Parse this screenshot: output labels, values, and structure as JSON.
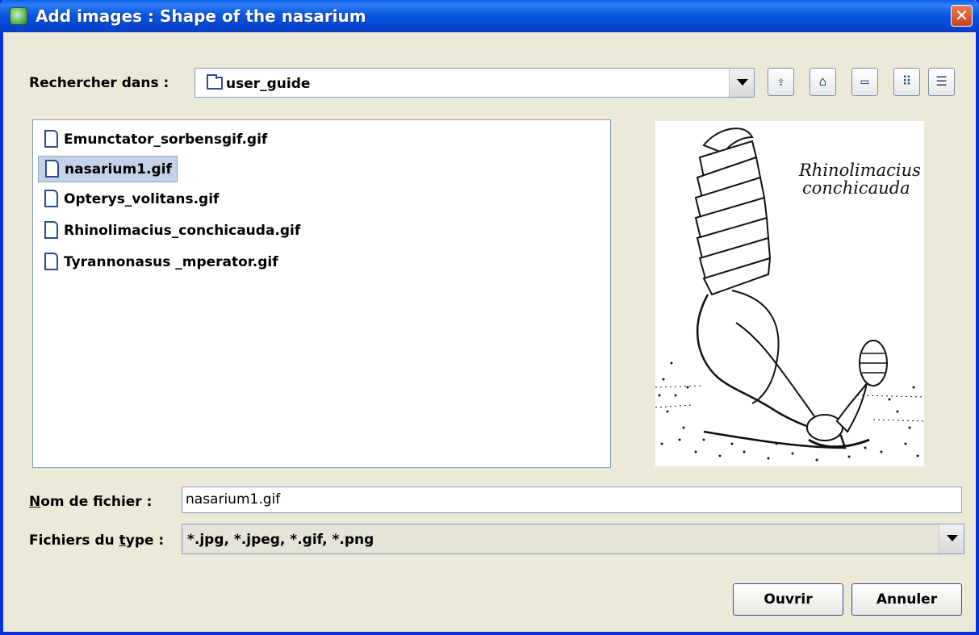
{
  "window": {
    "title": "Add images : Shape of the nasarium",
    "close_symbol": "✕"
  },
  "lookin": {
    "label": "Rechercher dans :",
    "value": "user_guide"
  },
  "toolbar": {
    "icons": [
      "up-folder-icon",
      "home-icon",
      "new-folder-icon",
      "list-view-icon",
      "details-view-icon"
    ]
  },
  "files": [
    {
      "name": "Emunctator_sorbensgif.gif",
      "selected": false
    },
    {
      "name": "nasarium1.gif",
      "selected": true
    },
    {
      "name": "Opterys_volitans.gif",
      "selected": false
    },
    {
      "name": "Rhinolimacius_conchicauda.gif",
      "selected": false
    },
    {
      "name": "Tyrannonasus _mperator.gif",
      "selected": false
    }
  ],
  "preview": {
    "caption_line1": "Rhinolimacius",
    "caption_line2": "conchicauda"
  },
  "filename": {
    "label_mnemonic": "N",
    "label_rest": "om de fichier :",
    "value": "nasarium1.gif"
  },
  "filetype": {
    "label_pre": "Fichiers du ",
    "label_mnemonic": "t",
    "label_post": "ype :",
    "value": "*.jpg, *.jpeg, *.gif, *.png"
  },
  "buttons": {
    "open": "Ouvrir",
    "cancel": "Annuler"
  }
}
